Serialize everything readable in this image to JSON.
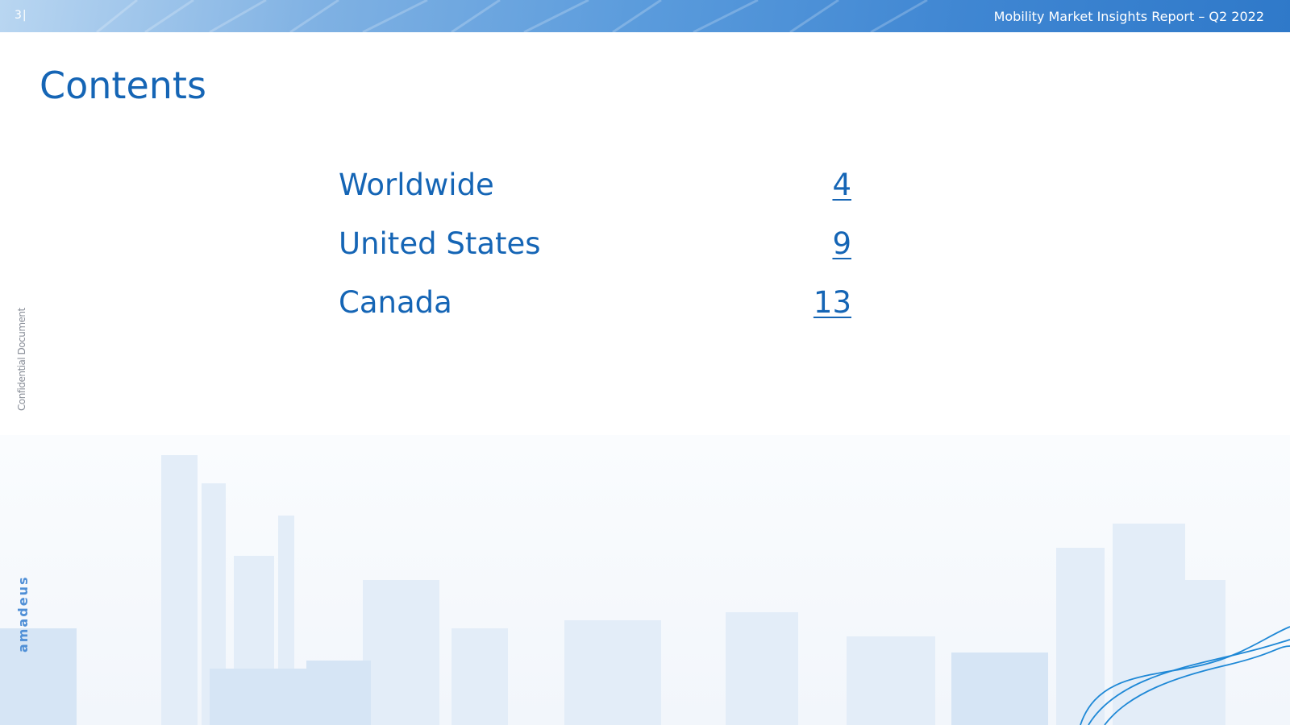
{
  "header": {
    "page_number": "3|",
    "report_title": "Mobility Market Insights Report – Q2 2022"
  },
  "title": "Contents",
  "toc": [
    {
      "label": "Worldwide",
      "page": "4"
    },
    {
      "label": "United States",
      "page": "9"
    },
    {
      "label": "Canada",
      "page": "13"
    }
  ],
  "side_text": "Confidential Document",
  "logo_text": "amadeus",
  "colors": {
    "accent": "#1565b5",
    "header_start": "#b9d6f1",
    "header_end": "#2f79c9",
    "side_text": "#8a8f99"
  }
}
